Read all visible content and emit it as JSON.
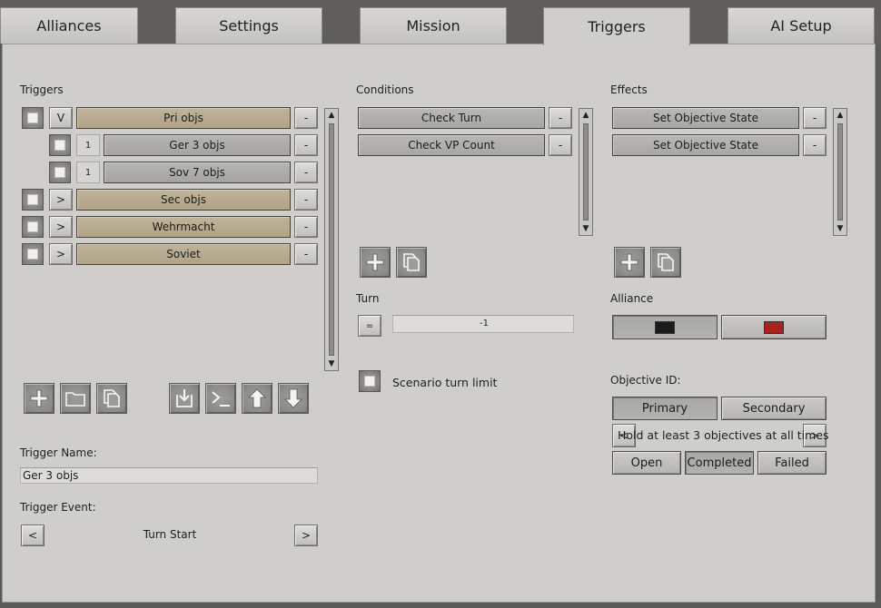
{
  "tabs": [
    {
      "label": "Alliances",
      "active": false
    },
    {
      "label": "Settings",
      "active": false
    },
    {
      "label": "Mission",
      "active": false
    },
    {
      "label": "Triggers",
      "active": true
    },
    {
      "label": "AI Setup",
      "active": false
    }
  ],
  "triggers": {
    "title": "Triggers",
    "items": [
      {
        "toggle": "V",
        "label": "Pri objs",
        "remove": "-"
      },
      {
        "count": "1",
        "label": "Ger 3 objs",
        "remove": "-"
      },
      {
        "count": "1",
        "label": "Sov 7 objs",
        "remove": "-"
      },
      {
        "toggle": ">",
        "label": "Sec objs",
        "remove": "-"
      },
      {
        "toggle": ">",
        "label": "Wehrmacht",
        "remove": "-"
      },
      {
        "toggle": ">",
        "label": "Soviet",
        "remove": "-"
      }
    ],
    "trigger_name_label": "Trigger Name:",
    "trigger_name_value": "Ger 3 objs",
    "trigger_event_label": "Trigger Event:",
    "trigger_event_value": "Turn Start",
    "prev": "<",
    "next": ">"
  },
  "conditions": {
    "title": "Conditions",
    "items": [
      {
        "label": "Check Turn",
        "remove": "-"
      },
      {
        "label": "Check VP Count",
        "remove": "-"
      }
    ],
    "turn_label": "Turn",
    "turn_operator": "=",
    "turn_value": "-1",
    "scenario_limit_label": "Scenario turn limit"
  },
  "effects": {
    "title": "Effects",
    "items": [
      {
        "label": "Set Objective State",
        "remove": "-"
      },
      {
        "label": "Set Objective State",
        "remove": "-"
      }
    ],
    "alliance_label": "Alliance",
    "alliance_colors": [
      "#1c1c1c",
      "#a8231d"
    ],
    "objective_id_label": "Objective ID:",
    "objective_tabs": [
      "Primary",
      "Secondary"
    ],
    "objective_text": "Hold at least 3 objectives at all times",
    "prev": "<",
    "next": ">",
    "state_buttons": [
      "Open",
      "Completed",
      "Failed"
    ],
    "selected_state": "Completed"
  },
  "scroll": {
    "up": "▲",
    "down": "▼"
  }
}
